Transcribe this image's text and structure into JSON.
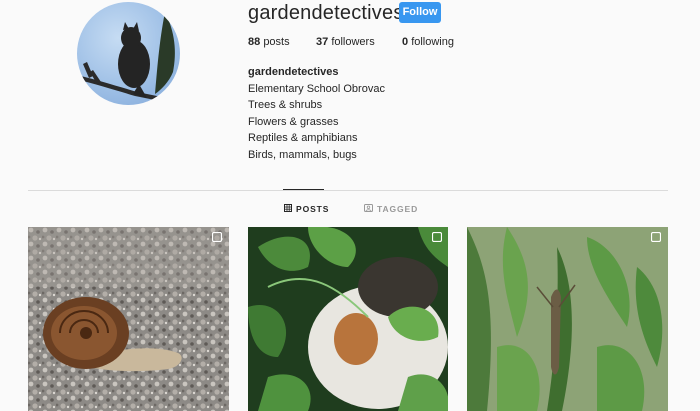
{
  "profile": {
    "username": "gardendetectives",
    "follow_label": "Follow",
    "stats": {
      "posts_count": "88",
      "posts_label": "posts",
      "followers_count": "37",
      "followers_label": "followers",
      "following_count": "0",
      "following_label": "following"
    },
    "bio": {
      "name": "gardendetectives",
      "lines": [
        "Elementary School Obrovac",
        "Trees & shrubs",
        "Flowers & grasses",
        "Reptiles & amphibians",
        "Birds, mammals, bugs"
      ]
    }
  },
  "tabs": {
    "posts_label": "POSTS",
    "tagged_label": "TAGGED",
    "active": "posts"
  },
  "icons": {
    "posts_tab": "grid-icon",
    "tagged_tab": "tag-icon",
    "post_overlay": "multiple-images-icon"
  },
  "colors": {
    "follow_button": "#3897f0",
    "background": "#fafafa",
    "divider": "#dbdbdb"
  }
}
